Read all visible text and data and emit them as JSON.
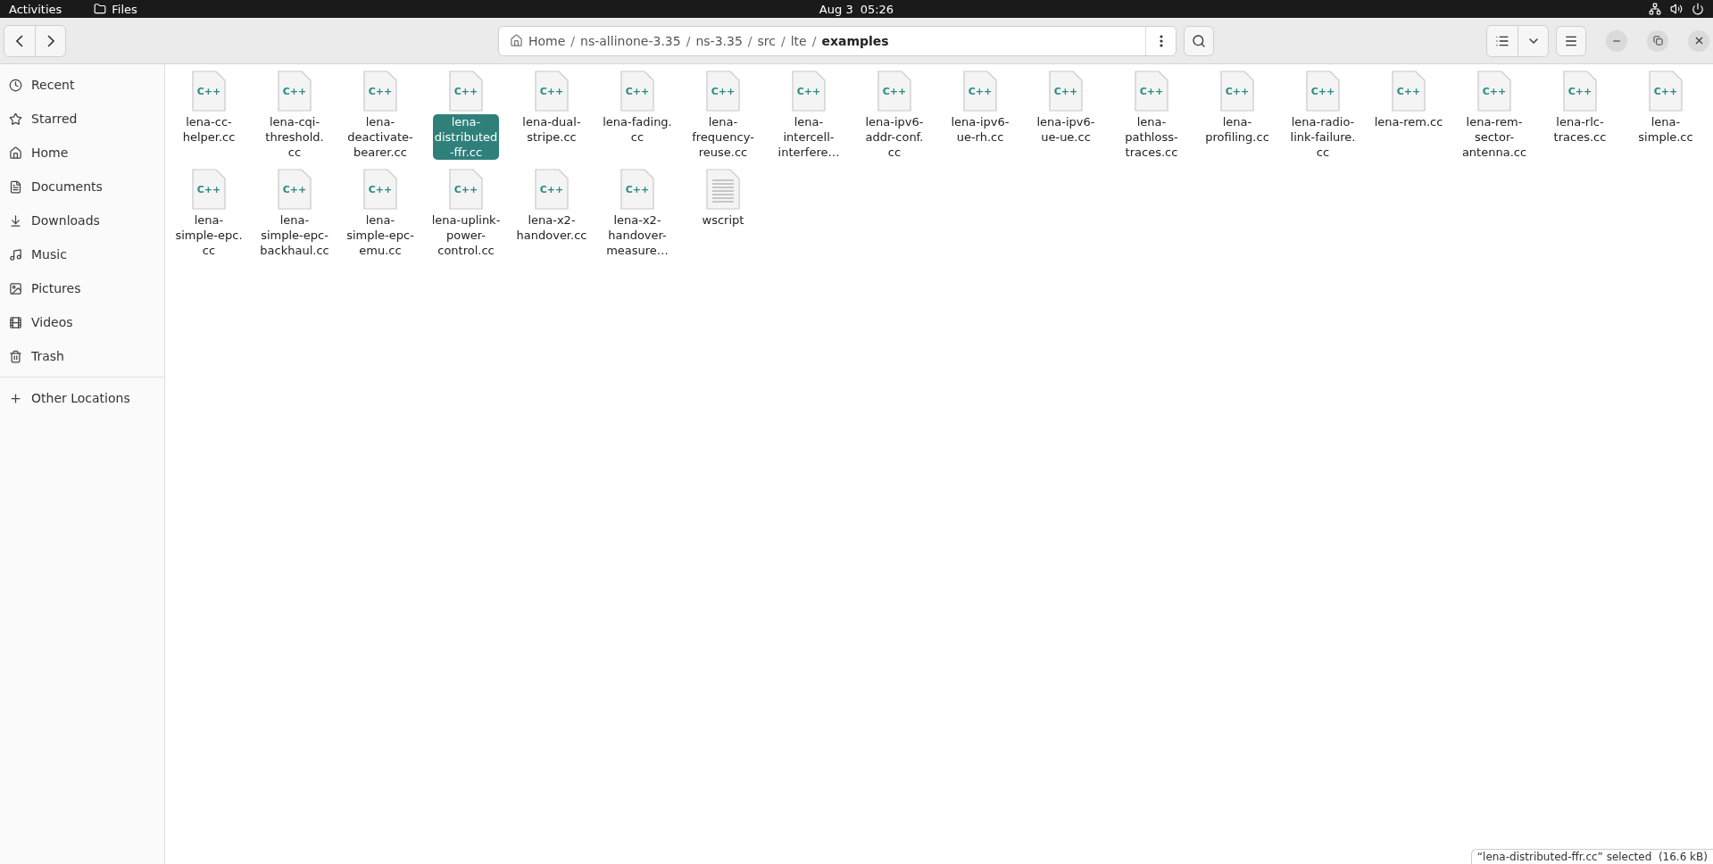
{
  "top_bar": {
    "activities": "Activities",
    "app": "Files",
    "date": "Aug 3",
    "time": "05:26"
  },
  "path_bar": {
    "separator": "/",
    "segments": [
      {
        "label": "Home",
        "kind": "home",
        "selected": false
      },
      {
        "label": "ns-allinone-3.35",
        "kind": "dir",
        "selected": false
      },
      {
        "label": "ns-3.35",
        "kind": "dir",
        "selected": false
      },
      {
        "label": "src",
        "kind": "dir",
        "selected": false
      },
      {
        "label": "lte",
        "kind": "dir",
        "selected": false
      },
      {
        "label": "examples",
        "kind": "dir",
        "selected": true
      }
    ]
  },
  "sidebar": {
    "items": [
      {
        "label": "Recent"
      },
      {
        "label": "Starred"
      },
      {
        "label": "Home"
      },
      {
        "label": "Documents"
      },
      {
        "label": "Downloads"
      },
      {
        "label": "Music"
      },
      {
        "label": "Pictures"
      },
      {
        "label": "Videos"
      },
      {
        "label": "Trash"
      }
    ],
    "other": {
      "label": "Other Locations"
    }
  },
  "files": [
    {
      "name": "lena-cc-\nhelper.cc",
      "kind": "cpp",
      "badge": "C++",
      "selected": false
    },
    {
      "name": "lena-cqi-\nthreshold.\ncc",
      "kind": "cpp",
      "badge": "C++",
      "selected": false
    },
    {
      "name": "lena-\ndeactivate-\nbearer.cc",
      "kind": "cpp",
      "badge": "C++",
      "selected": false
    },
    {
      "name": "lena-\ndistributed\n-ffr.cc",
      "kind": "cpp",
      "badge": "C++",
      "selected": true
    },
    {
      "name": "lena-dual-\nstripe.cc",
      "kind": "cpp",
      "badge": "C++",
      "selected": false
    },
    {
      "name": "lena-fading.\ncc",
      "kind": "cpp",
      "badge": "C++",
      "selected": false
    },
    {
      "name": "lena-\nfrequency-\nreuse.cc",
      "kind": "cpp",
      "badge": "C++",
      "selected": false
    },
    {
      "name": "lena-\nintercell-\ninterfere…",
      "kind": "cpp",
      "badge": "C++",
      "selected": false
    },
    {
      "name": "lena-ipv6-\naddr-conf.\ncc",
      "kind": "cpp",
      "badge": "C++",
      "selected": false
    },
    {
      "name": "lena-ipv6-\nue-rh.cc",
      "kind": "cpp",
      "badge": "C++",
      "selected": false
    },
    {
      "name": "lena-ipv6-\nue-ue.cc",
      "kind": "cpp",
      "badge": "C++",
      "selected": false
    },
    {
      "name": "lena-\npathloss-\ntraces.cc",
      "kind": "cpp",
      "badge": "C++",
      "selected": false
    },
    {
      "name": "lena-\nprofiling.cc",
      "kind": "cpp",
      "badge": "C++",
      "selected": false
    },
    {
      "name": "lena-radio-\nlink-failure.\ncc",
      "kind": "cpp",
      "badge": "C++",
      "selected": false
    },
    {
      "name": "lena-rem.cc",
      "kind": "cpp",
      "badge": "C++",
      "selected": false
    },
    {
      "name": "lena-rem-\nsector-\nantenna.cc",
      "kind": "cpp",
      "badge": "C++",
      "selected": false
    },
    {
      "name": "lena-rlc-\ntraces.cc",
      "kind": "cpp",
      "badge": "C++",
      "selected": false
    },
    {
      "name": "lena-\nsimple.cc",
      "kind": "cpp",
      "badge": "C++",
      "selected": false
    },
    {
      "name": "lena-\nsimple-epc.\ncc",
      "kind": "cpp",
      "badge": "C++",
      "selected": false
    },
    {
      "name": "lena-\nsimple-epc-\nbackhaul.cc",
      "kind": "cpp",
      "badge": "C++",
      "selected": false
    },
    {
      "name": "lena-\nsimple-epc-\nemu.cc",
      "kind": "cpp",
      "badge": "C++",
      "selected": false
    },
    {
      "name": "lena-uplink-\npower-\ncontrol.cc",
      "kind": "cpp",
      "badge": "C++",
      "selected": false
    },
    {
      "name": "lena-x2-\nhandover.cc",
      "kind": "cpp",
      "badge": "C++",
      "selected": false
    },
    {
      "name": "lena-x2-\nhandover-\nmeasure…",
      "kind": "cpp",
      "badge": "C++",
      "selected": false
    },
    {
      "name": "wscript",
      "kind": "text",
      "selected": false
    }
  ],
  "status": "“lena-distributed-ffr.cc” selected  (16.6 kB)"
}
